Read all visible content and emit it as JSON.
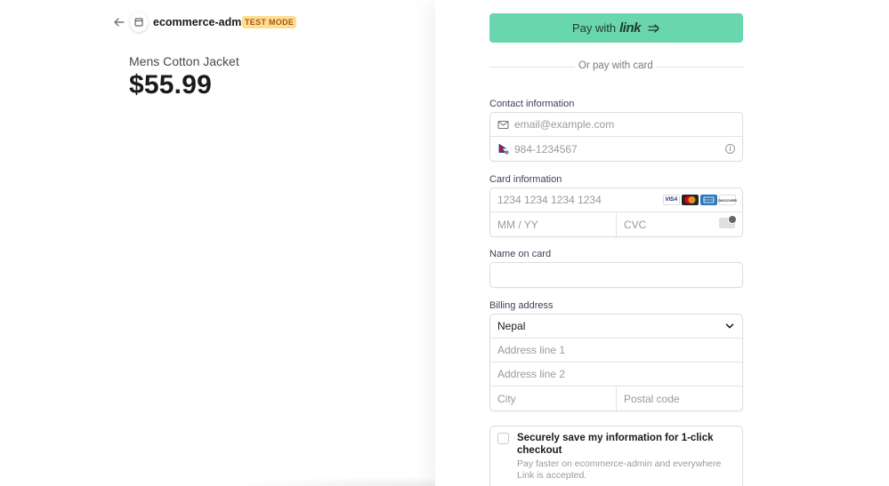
{
  "merchant": {
    "name": "ecommerce-admin",
    "test_mode_badge": "TEST MODE"
  },
  "product": {
    "name": "Mens Cotton Jacket",
    "price": "$55.99"
  },
  "link_button": {
    "label": "Pay with",
    "brand": "link",
    "color": "#6ad6ae"
  },
  "divider": {
    "text": "Or pay with card"
  },
  "contact": {
    "label": "Contact information",
    "email_placeholder": "email@example.com",
    "phone_placeholder": "984-1234567"
  },
  "card": {
    "label": "Card information",
    "number_placeholder": "1234 1234 1234 1234",
    "expiry_placeholder": "MM / YY",
    "cvc_placeholder": "CVC",
    "brands": [
      "VISA",
      "mastercard",
      "amex",
      "DISCOVER"
    ]
  },
  "name_on_card": {
    "label": "Name on card",
    "value": ""
  },
  "billing": {
    "label": "Billing address",
    "country": "Nepal",
    "address1_placeholder": "Address line 1",
    "address2_placeholder": "Address line 2",
    "city_placeholder": "City",
    "postal_placeholder": "Postal code"
  },
  "save_info": {
    "title": "Securely save my information for 1-click checkout",
    "description": "Pay faster on ecommerce-admin and everywhere Link is accepted."
  }
}
